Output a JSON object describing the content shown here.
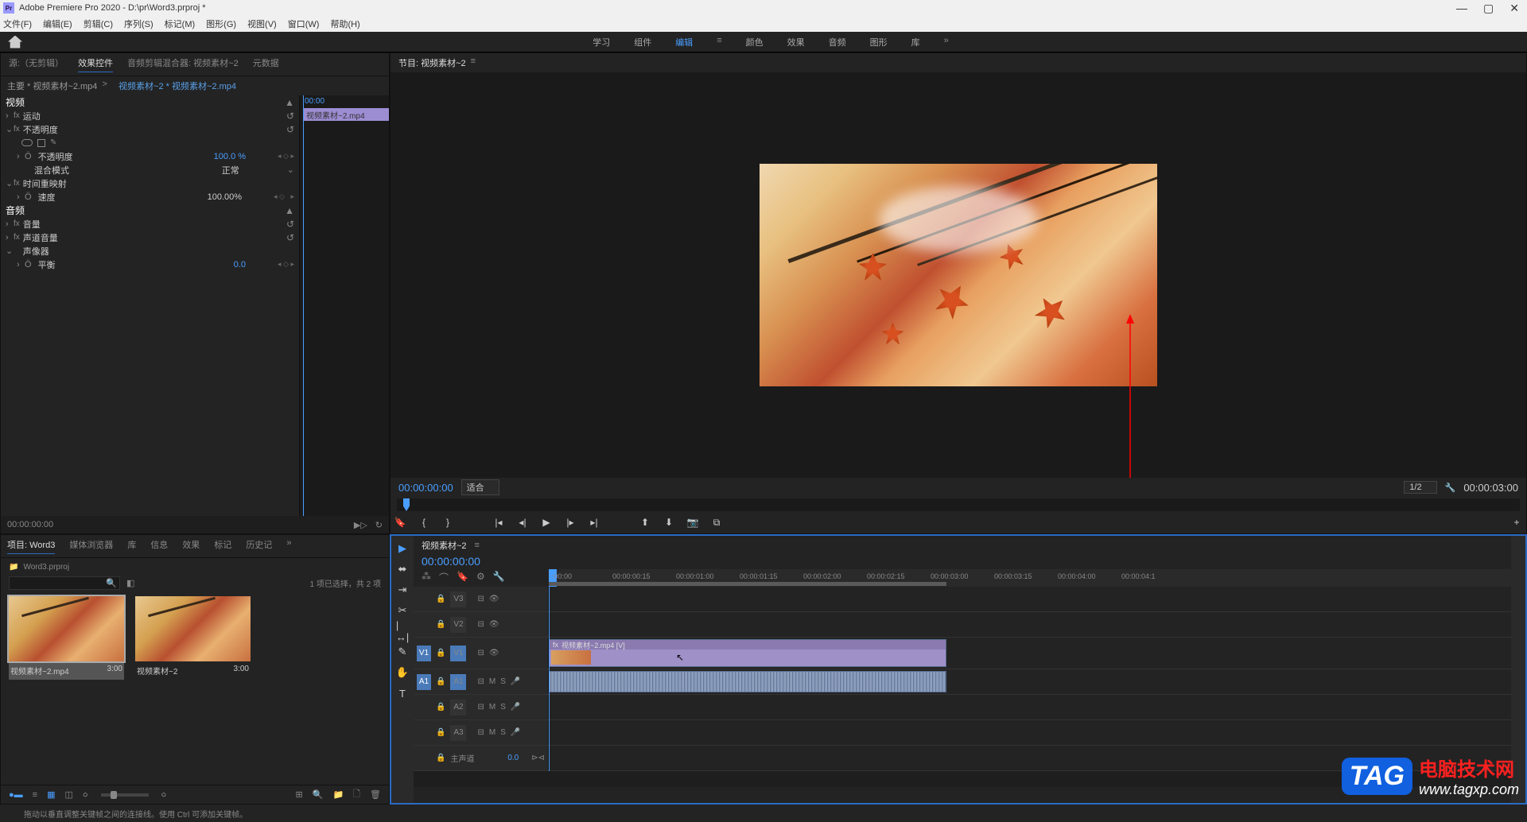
{
  "title": "Adobe Premiere Pro 2020 - D:\\pr\\Word3.prproj *",
  "menu": [
    "文件(F)",
    "编辑(E)",
    "剪辑(C)",
    "序列(S)",
    "标记(M)",
    "图形(G)",
    "视图(V)",
    "窗口(W)",
    "帮助(H)"
  ],
  "workspace_tabs": [
    "学习",
    "组件",
    "编辑",
    "颜色",
    "效果",
    "音频",
    "图形",
    "库"
  ],
  "workspace_active": "编辑",
  "source_tabs": {
    "source": "源:（无剪辑）",
    "effect_controls": "效果控件",
    "audio_mixer": "音频剪辑混合器: 视频素材~2",
    "metadata": "元数据"
  },
  "ec": {
    "master": "主要 * 视频素材~2.mp4",
    "clip": "视频素材~2 * 视频素材~2.mp4",
    "timeline_tc": "00:00",
    "timeline_clip": "视频素材~2.mp4",
    "sections": {
      "video": "视频",
      "motion": "运动",
      "opacity": "不透明度",
      "opacity_prop": "不透明度",
      "opacity_val": "100.0 %",
      "blend_mode": "混合模式",
      "blend_val": "正常",
      "time_remap": "时间重映射",
      "speed": "速度",
      "speed_val": "100.00%",
      "audio": "音频",
      "volume": "音量",
      "channel_vol": "声道音量",
      "panner": "声像器",
      "balance": "平衡",
      "balance_val": "0.0"
    }
  },
  "ec_bottom_tc": "00:00:00:00",
  "project_tabs": [
    "项目: Word3",
    "媒体浏览器",
    "库",
    "信息",
    "效果",
    "标记",
    "历史记"
  ],
  "project_file": "Word3.prproj",
  "search_placeholder": "",
  "project_status": "1 项已选择，共 2 项",
  "clips": [
    {
      "name": "视频素材~2.mp4",
      "dur": "3:00",
      "selected": true
    },
    {
      "name": "视频素材~2",
      "dur": "3:00",
      "selected": false
    }
  ],
  "program": {
    "title": "节目: 视频素材~2",
    "tc_left": "00:00:00:00",
    "zoom": "适合",
    "res": "1/2",
    "tc_right": "00:00:03:00"
  },
  "timeline": {
    "seq": "视频素材~2",
    "tc": "00:00:00:00",
    "ruler": [
      ":00:00",
      "00:00:00:15",
      "00:00:01:00",
      "00:00:01:15",
      "00:00:02:00",
      "00:00:02:15",
      "00:00:03:00",
      "00:00:03:15",
      "00:00:04:00",
      "00:00:04:1"
    ],
    "tracks_v": [
      "V3",
      "V2",
      "V1"
    ],
    "tracks_a": [
      "A1",
      "A2",
      "A3"
    ],
    "master": "主声道",
    "master_val": "0.0",
    "clip_name": "视频素材~2.mp4 [V]"
  },
  "status": "拖动以垂直调整关键帧之间的连接线。使用 Ctrl 可添加关键帧。",
  "watermark": {
    "tag": "TAG",
    "line1": "电脑技术网",
    "line2": "www.tagxp.com"
  }
}
